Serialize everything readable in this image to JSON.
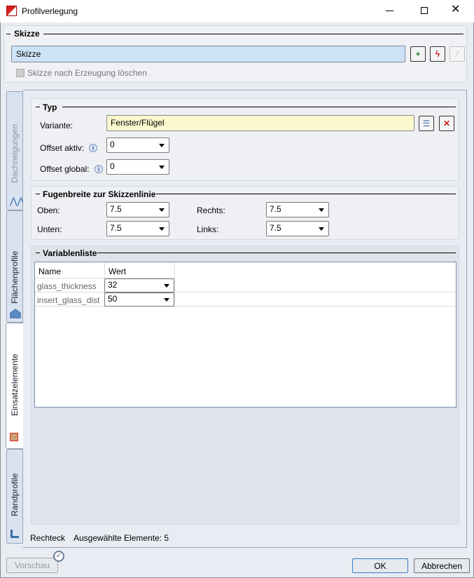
{
  "window": {
    "title": "Profilverlegung"
  },
  "skizze": {
    "title": "Skizze",
    "field_value": "Skizze",
    "checkbox_label": "Skizze nach Erzeugung löschen"
  },
  "tabs": [
    {
      "label": "Dachneigungen"
    },
    {
      "label": "Flächenprofile"
    },
    {
      "label": "Einsatzelemente"
    },
    {
      "label": "Randprofile"
    }
  ],
  "typ": {
    "title": "Typ",
    "variante_label": "Variante:",
    "variante_value": "Fenster/Flügel",
    "offset_aktiv_label": "Offset aktiv:",
    "offset_aktiv_value": "0",
    "offset_global_label": "Offset global:",
    "offset_global_value": "0"
  },
  "fugen": {
    "title": "Fugenbreite zur Skizzenlinie",
    "oben_label": "Oben:",
    "oben_value": "7.5",
    "unten_label": "Unten:",
    "unten_value": "7.5",
    "rechts_label": "Rechts:",
    "rechts_value": "7.5",
    "links_label": "Links:",
    "links_value": "7.5"
  },
  "variablen": {
    "title": "Variablenliste",
    "columns": [
      "Name",
      "Wert"
    ],
    "rows": [
      {
        "name": "glass_thickness",
        "value": "32"
      },
      {
        "name": "insert_glass_dist",
        "value": "50"
      }
    ]
  },
  "status": {
    "type": "Rechteck",
    "selected": "Ausgewählte Elemente: 5"
  },
  "buttons": {
    "preview": "Vorschau",
    "ok": "OK",
    "cancel": "Abbrechen"
  }
}
